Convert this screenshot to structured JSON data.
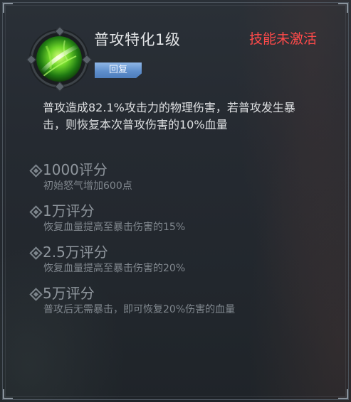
{
  "skill": {
    "name": "普攻特化1级",
    "status": "技能未激活",
    "tag": "回复",
    "icon": "green-slash-skill-icon",
    "description": "普攻造成82.1%攻击力的物理伤害，若普攻发生暴击，则恢复本次普攻伤害的10%血量"
  },
  "tiers": [
    {
      "score": "1000评分",
      "effect": "初始怒气增加600点"
    },
    {
      "score": "1万评分",
      "effect": "恢复血量提高至暴击伤害的15%"
    },
    {
      "score": "2.5万评分",
      "effect": "恢复血量提高至暴击伤害的20%"
    },
    {
      "score": "5万评分",
      "effect": "普攻后无需暴击，即可恢复20%伤害的血量"
    }
  ],
  "colors": {
    "status": "#ff4a4a",
    "tag": "#5f8fcc",
    "title": "#e2e4e6",
    "tier_text": "#80878e"
  }
}
